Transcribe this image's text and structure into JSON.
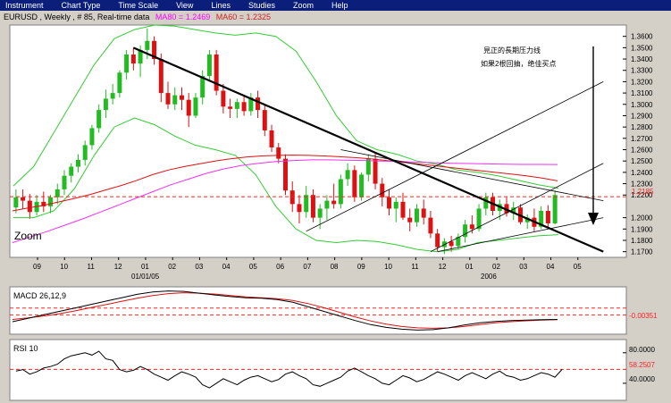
{
  "menu": {
    "items": [
      "Instrument",
      "Chart Type",
      "Time Scale",
      "View",
      "Lines",
      "Studies",
      "Zoom",
      "Help"
    ]
  },
  "header": {
    "symbol_info": "EURUSD , Weekly , # 85, Real-time data",
    "ma80_label": "MA80 = 1.2469",
    "ma60_label": "MA60 = 1.2325"
  },
  "colors": {
    "background": "#d4d0c8",
    "panel": "#ffffff",
    "menubar": "#0a1e7a",
    "up_candle": "#22bb22",
    "down_candle": "#dd1111",
    "bollinger": "#33cc33",
    "ma_red": "#dd1111",
    "ma_magenta": "#ee33ee",
    "trendline": "#000000",
    "level_line": "#ff2222"
  },
  "main_panel": {
    "zoom_label": "Zoom",
    "annotation_line1": "見正的長期压力线",
    "annotation_line2": "如果2根回抽，绝佳买点",
    "current_level_label": "1.2185",
    "price_axis": [
      "1.3600",
      "1.3500",
      "1.3400",
      "1.3300",
      "1.3200",
      "1.3100",
      "1.3000",
      "1.2900",
      "1.2800",
      "1.2700",
      "1.2600",
      "1.2500",
      "1.2400",
      "1.2300",
      "1.2200",
      "1.2000",
      "1.1900",
      "1.1800",
      "1.1700"
    ],
    "month_labels": [
      "09",
      "10",
      "11",
      "12",
      "01",
      "02",
      "03",
      "04",
      "05",
      "06",
      "07",
      "08",
      "09",
      "10",
      "11",
      "12",
      "01",
      "02",
      "03",
      "04",
      "05"
    ],
    "year_labels": [
      "01/01/05",
      "2006"
    ]
  },
  "macd_panel": {
    "title": "MACD 26,12,9",
    "value_label": "-0.00351"
  },
  "rsi_panel": {
    "title": "RSI 10",
    "axis": [
      "80.0000",
      "58.2507",
      "40.0000"
    ]
  },
  "chart_data": {
    "type": "candlestick",
    "title": "EURUSD , Weekly , # 85, Real-time data",
    "ylim": [
      1.165,
      1.37
    ],
    "candles": [
      [
        1.209,
        1.225,
        1.204,
        1.218
      ],
      [
        1.218,
        1.225,
        1.208,
        1.215
      ],
      [
        1.215,
        1.221,
        1.199,
        1.205
      ],
      [
        1.205,
        1.22,
        1.202,
        1.214
      ],
      [
        1.214,
        1.223,
        1.205,
        1.21
      ],
      [
        1.21,
        1.22,
        1.204,
        1.218
      ],
      [
        1.218,
        1.23,
        1.212,
        1.225
      ],
      [
        1.225,
        1.242,
        1.22,
        1.237
      ],
      [
        1.237,
        1.248,
        1.231,
        1.245
      ],
      [
        1.245,
        1.256,
        1.24,
        1.251
      ],
      [
        1.251,
        1.268,
        1.246,
        1.264
      ],
      [
        1.264,
        1.282,
        1.26,
        1.279
      ],
      [
        1.279,
        1.3,
        1.275,
        1.295
      ],
      [
        1.295,
        1.313,
        1.288,
        1.305
      ],
      [
        1.305,
        1.318,
        1.3,
        1.31
      ],
      [
        1.31,
        1.33,
        1.306,
        1.328
      ],
      [
        1.328,
        1.348,
        1.322,
        1.344
      ],
      [
        1.344,
        1.35,
        1.33,
        1.336
      ],
      [
        1.336,
        1.352,
        1.324,
        1.348
      ],
      [
        1.348,
        1.367,
        1.34,
        1.356
      ],
      [
        1.356,
        1.36,
        1.335,
        1.34
      ],
      [
        1.34,
        1.345,
        1.302,
        1.31
      ],
      [
        1.31,
        1.32,
        1.296,
        1.3
      ],
      [
        1.3,
        1.315,
        1.295,
        1.308
      ],
      [
        1.308,
        1.315,
        1.295,
        1.304
      ],
      [
        1.304,
        1.31,
        1.28,
        1.29
      ],
      [
        1.29,
        1.31,
        1.288,
        1.306
      ],
      [
        1.306,
        1.33,
        1.3,
        1.325
      ],
      [
        1.325,
        1.348,
        1.32,
        1.344
      ],
      [
        1.344,
        1.348,
        1.308,
        1.312
      ],
      [
        1.312,
        1.318,
        1.292,
        1.298
      ],
      [
        1.298,
        1.305,
        1.288,
        1.296
      ],
      [
        1.296,
        1.305,
        1.288,
        1.302
      ],
      [
        1.302,
        1.308,
        1.29,
        1.294
      ],
      [
        1.294,
        1.31,
        1.29,
        1.306
      ],
      [
        1.306,
        1.312,
        1.288,
        1.295
      ],
      [
        1.295,
        1.3,
        1.272,
        1.277
      ],
      [
        1.277,
        1.282,
        1.258,
        1.262
      ],
      [
        1.262,
        1.266,
        1.248,
        1.252
      ],
      [
        1.252,
        1.256,
        1.22,
        1.224
      ],
      [
        1.224,
        1.232,
        1.205,
        1.212
      ],
      [
        1.212,
        1.22,
        1.195,
        1.205
      ],
      [
        1.205,
        1.228,
        1.2,
        1.22
      ],
      [
        1.22,
        1.225,
        1.196,
        1.2
      ],
      [
        1.2,
        1.212,
        1.19,
        1.208
      ],
      [
        1.208,
        1.22,
        1.198,
        1.215
      ],
      [
        1.215,
        1.23,
        1.208,
        1.212
      ],
      [
        1.212,
        1.238,
        1.208,
        1.234
      ],
      [
        1.234,
        1.248,
        1.228,
        1.242
      ],
      [
        1.242,
        1.246,
        1.214,
        1.218
      ],
      [
        1.218,
        1.24,
        1.215,
        1.238
      ],
      [
        1.238,
        1.256,
        1.232,
        1.252
      ],
      [
        1.252,
        1.258,
        1.225,
        1.23
      ],
      [
        1.23,
        1.235,
        1.21,
        1.218
      ],
      [
        1.218,
        1.225,
        1.202,
        1.208
      ],
      [
        1.208,
        1.218,
        1.196,
        1.214
      ],
      [
        1.214,
        1.222,
        1.198,
        1.2
      ],
      [
        1.2,
        1.208,
        1.188,
        1.196
      ],
      [
        1.196,
        1.212,
        1.192,
        1.208
      ],
      [
        1.208,
        1.216,
        1.194,
        1.2
      ],
      [
        1.2,
        1.206,
        1.182,
        1.186
      ],
      [
        1.186,
        1.19,
        1.17,
        1.174
      ],
      [
        1.174,
        1.182,
        1.168,
        1.179
      ],
      [
        1.179,
        1.184,
        1.17,
        1.175
      ],
      [
        1.175,
        1.186,
        1.172,
        1.183
      ],
      [
        1.183,
        1.198,
        1.178,
        1.194
      ],
      [
        1.194,
        1.202,
        1.186,
        1.19
      ],
      [
        1.19,
        1.212,
        1.188,
        1.208
      ],
      [
        1.208,
        1.222,
        1.202,
        1.218
      ],
      [
        1.218,
        1.222,
        1.202,
        1.206
      ],
      [
        1.206,
        1.216,
        1.198,
        1.212
      ],
      [
        1.212,
        1.218,
        1.201,
        1.204
      ],
      [
        1.204,
        1.214,
        1.198,
        1.209
      ],
      [
        1.209,
        1.212,
        1.194,
        1.196
      ],
      [
        1.196,
        1.203,
        1.19,
        1.2
      ],
      [
        1.2,
        1.208,
        1.188,
        1.192
      ],
      [
        1.192,
        1.21,
        1.19,
        1.206
      ],
      [
        1.206,
        1.211,
        1.192,
        1.195
      ],
      [
        1.195,
        1.224,
        1.194,
        1.22
      ]
    ],
    "ma60": [
      1.206,
      1.2085,
      1.211,
      1.214,
      1.217,
      1.2205,
      1.2245,
      1.2285,
      1.233,
      1.238,
      1.242,
      1.245,
      1.2475,
      1.25,
      1.252,
      1.2535,
      1.2545,
      1.255,
      1.2552,
      1.255,
      1.2545,
      1.2538,
      1.253,
      1.252,
      1.2505,
      1.249,
      1.2475,
      1.246,
      1.2445,
      1.243,
      1.2415,
      1.24,
      1.2385,
      1.237,
      1.235,
      1.2325
    ],
    "ma80": [
      1.178,
      1.183,
      1.188,
      1.1935,
      1.199,
      1.205,
      1.211,
      1.217,
      1.223,
      1.229,
      1.234,
      1.239,
      1.243,
      1.246,
      1.248,
      1.2495,
      1.2505,
      1.251,
      1.251,
      1.2508,
      1.2505,
      1.25,
      1.2495,
      1.249,
      1.2485,
      1.248,
      1.2478,
      1.2475,
      1.2472,
      1.247,
      1.247,
      1.2469
    ],
    "bb_upper": [
      1.228,
      1.245,
      1.275,
      1.305,
      1.335,
      1.358,
      1.366,
      1.37,
      1.369,
      1.366,
      1.363,
      1.361,
      1.363,
      1.36,
      1.347,
      1.32,
      1.29,
      1.268,
      1.26,
      1.256,
      1.25,
      1.247,
      1.242,
      1.24,
      1.237,
      1.233,
      1.229,
      1.226
    ],
    "bb_lower": [
      1.2,
      1.2,
      1.206,
      1.225,
      1.255,
      1.28,
      1.288,
      1.282,
      1.272,
      1.264,
      1.26,
      1.255,
      1.238,
      1.21,
      1.19,
      1.18,
      1.178,
      1.18,
      1.179,
      1.176,
      1.172,
      1.17,
      1.172,
      1.178,
      1.18,
      1.182,
      1.184,
      1.185
    ],
    "level_line": 1.2185,
    "trendlines": [
      {
        "from": [
          17,
          1.35
        ],
        "to": [
          85,
          1.17
        ]
      },
      {
        "from": [
          47,
          1.26
        ],
        "to": [
          85,
          1.215
        ]
      },
      {
        "from": [
          42,
          1.188
        ],
        "to": [
          85,
          1.32
        ]
      },
      {
        "from": [
          60,
          1.17
        ],
        "to": [
          85,
          1.248
        ]
      },
      {
        "from": [
          61,
          1.17
        ],
        "to": [
          85,
          1.2
        ]
      }
    ],
    "macd": {
      "title": "MACD 26,12,9",
      "macd_line": [
        -0.0045,
        -0.003,
        -0.0015,
        0.0,
        0.0015,
        0.003,
        0.0045,
        0.006,
        0.0075,
        0.0085,
        0.009,
        0.0088,
        0.008,
        0.0072,
        0.0065,
        0.006,
        0.0058,
        0.0052,
        0.004,
        0.002,
        0.0,
        -0.002,
        -0.004,
        -0.0058,
        -0.007,
        -0.0078,
        -0.0082,
        -0.008,
        -0.0072,
        -0.006,
        -0.005,
        -0.0044,
        -0.004,
        -0.0038,
        -0.0036,
        -0.0035
      ],
      "signal_line": [
        -0.0035,
        -0.0028,
        -0.002,
        -0.001,
        0.0002,
        0.0016,
        0.003,
        0.0044,
        0.0058,
        0.007,
        0.0078,
        0.0082,
        0.008,
        0.0076,
        0.007,
        0.0064,
        0.006,
        0.0056,
        0.0048,
        0.0034,
        0.0016,
        -0.0004,
        -0.0024,
        -0.0042,
        -0.0056,
        -0.0066,
        -0.0072,
        -0.0074,
        -0.0072,
        -0.0066,
        -0.0058,
        -0.005,
        -0.0045,
        -0.0041,
        -0.0038,
        -0.0036
      ],
      "level": -0.00351
    },
    "rsi": {
      "title": "RSI 10",
      "ylim": [
        20,
        95
      ],
      "values": [
        56,
        58,
        52,
        55,
        60,
        62,
        65,
        72,
        76,
        78,
        80,
        77,
        82,
        72,
        70,
        58,
        55,
        57,
        62,
        58,
        52,
        48,
        44,
        50,
        55,
        52,
        48,
        38,
        34,
        40,
        46,
        42,
        38,
        44,
        48,
        50,
        46,
        42,
        45,
        52,
        55,
        50,
        46,
        38,
        36,
        40,
        44,
        48,
        56,
        60,
        55,
        50,
        46,
        40,
        38,
        44,
        50,
        47,
        42,
        45,
        50,
        55,
        52,
        48,
        44,
        50,
        54,
        50,
        46,
        52,
        56,
        50,
        48,
        44,
        46,
        50,
        54,
        52,
        48,
        58
      ],
      "level": 58.2507
    }
  }
}
